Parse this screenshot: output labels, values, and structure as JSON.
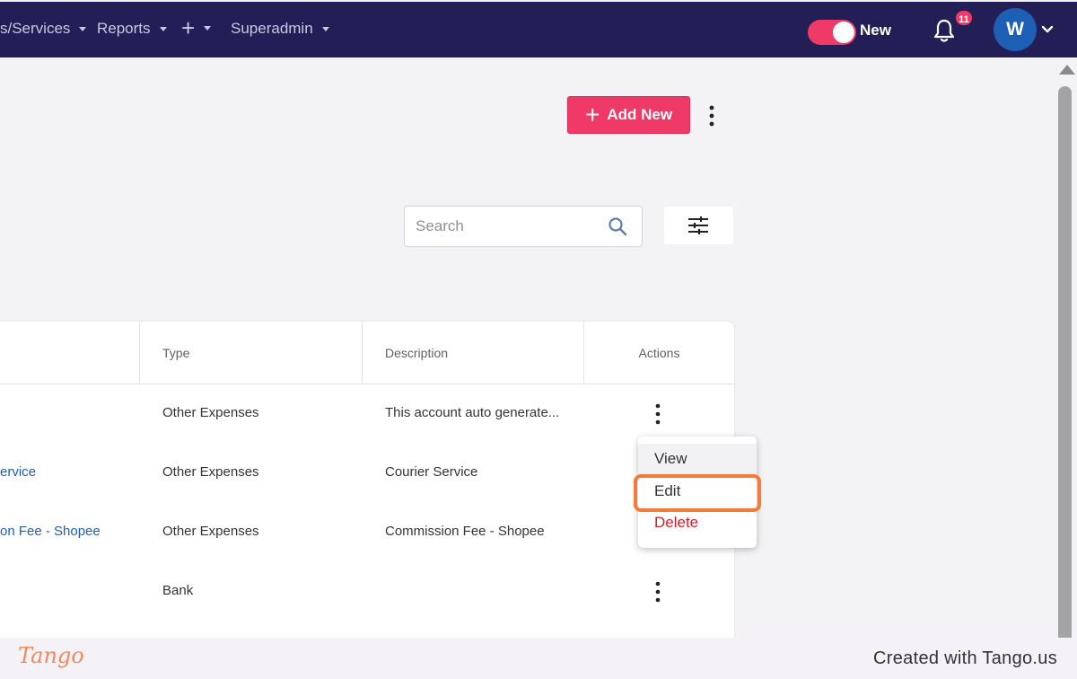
{
  "nav": {
    "items": [
      {
        "label": "s/Services"
      },
      {
        "label": "Reports"
      },
      {
        "label": "+"
      },
      {
        "label": "Superadmin"
      }
    ],
    "toggle_label": "New",
    "notification_count": "11",
    "avatar_initial": "W",
    "colors": {
      "bar": "#231f56",
      "accent": "#ef3a67",
      "avatar": "#1d5fb5"
    }
  },
  "toolbar": {
    "add_new_label": "Add New",
    "search_placeholder": "Search"
  },
  "table": {
    "headers": [
      "Type",
      "Description",
      "Actions"
    ],
    "rows": [
      {
        "name": "",
        "type": "Other Expenses",
        "description": "This account auto generate..."
      },
      {
        "name": "ervice",
        "type": "Other Expenses",
        "description": "Courier Service"
      },
      {
        "name": "on Fee - Shopee",
        "type": "Other Expenses",
        "description": "Commission Fee - Shopee"
      },
      {
        "name": "",
        "type": "Bank",
        "description": ""
      }
    ]
  },
  "menu": {
    "items": [
      {
        "label": "View"
      },
      {
        "label": "Edit"
      },
      {
        "label": "Delete"
      }
    ]
  },
  "footer": {
    "logo": "Tango",
    "credit": "Created with Tango.us"
  }
}
